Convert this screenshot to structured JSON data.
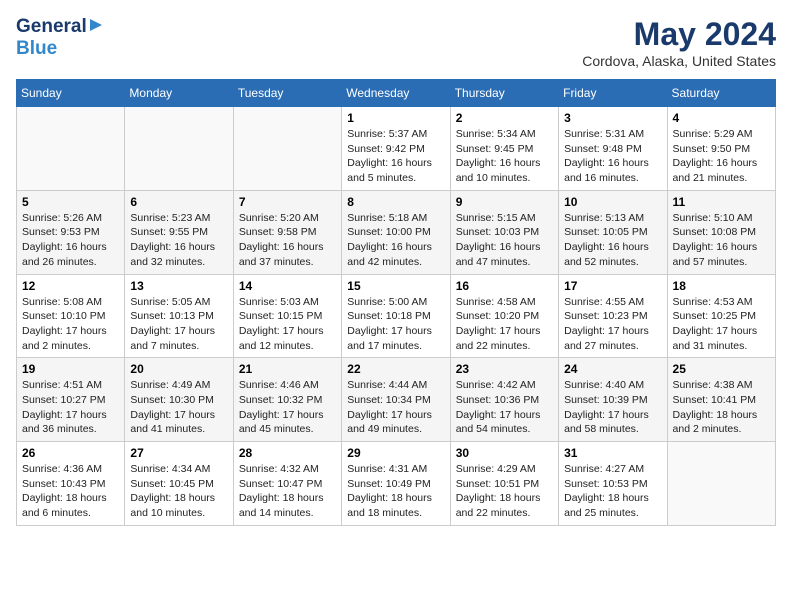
{
  "header": {
    "logo_general": "General",
    "logo_blue": "Blue",
    "month_year": "May 2024",
    "location": "Cordova, Alaska, United States"
  },
  "days_of_week": [
    "Sunday",
    "Monday",
    "Tuesday",
    "Wednesday",
    "Thursday",
    "Friday",
    "Saturday"
  ],
  "weeks": [
    [
      {
        "day": "",
        "content": ""
      },
      {
        "day": "",
        "content": ""
      },
      {
        "day": "",
        "content": ""
      },
      {
        "day": "1",
        "content": "Sunrise: 5:37 AM\nSunset: 9:42 PM\nDaylight: 16 hours\nand 5 minutes."
      },
      {
        "day": "2",
        "content": "Sunrise: 5:34 AM\nSunset: 9:45 PM\nDaylight: 16 hours\nand 10 minutes."
      },
      {
        "day": "3",
        "content": "Sunrise: 5:31 AM\nSunset: 9:48 PM\nDaylight: 16 hours\nand 16 minutes."
      },
      {
        "day": "4",
        "content": "Sunrise: 5:29 AM\nSunset: 9:50 PM\nDaylight: 16 hours\nand 21 minutes."
      }
    ],
    [
      {
        "day": "5",
        "content": "Sunrise: 5:26 AM\nSunset: 9:53 PM\nDaylight: 16 hours\nand 26 minutes."
      },
      {
        "day": "6",
        "content": "Sunrise: 5:23 AM\nSunset: 9:55 PM\nDaylight: 16 hours\nand 32 minutes."
      },
      {
        "day": "7",
        "content": "Sunrise: 5:20 AM\nSunset: 9:58 PM\nDaylight: 16 hours\nand 37 minutes."
      },
      {
        "day": "8",
        "content": "Sunrise: 5:18 AM\nSunset: 10:00 PM\nDaylight: 16 hours\nand 42 minutes."
      },
      {
        "day": "9",
        "content": "Sunrise: 5:15 AM\nSunset: 10:03 PM\nDaylight: 16 hours\nand 47 minutes."
      },
      {
        "day": "10",
        "content": "Sunrise: 5:13 AM\nSunset: 10:05 PM\nDaylight: 16 hours\nand 52 minutes."
      },
      {
        "day": "11",
        "content": "Sunrise: 5:10 AM\nSunset: 10:08 PM\nDaylight: 16 hours\nand 57 minutes."
      }
    ],
    [
      {
        "day": "12",
        "content": "Sunrise: 5:08 AM\nSunset: 10:10 PM\nDaylight: 17 hours\nand 2 minutes."
      },
      {
        "day": "13",
        "content": "Sunrise: 5:05 AM\nSunset: 10:13 PM\nDaylight: 17 hours\nand 7 minutes."
      },
      {
        "day": "14",
        "content": "Sunrise: 5:03 AM\nSunset: 10:15 PM\nDaylight: 17 hours\nand 12 minutes."
      },
      {
        "day": "15",
        "content": "Sunrise: 5:00 AM\nSunset: 10:18 PM\nDaylight: 17 hours\nand 17 minutes."
      },
      {
        "day": "16",
        "content": "Sunrise: 4:58 AM\nSunset: 10:20 PM\nDaylight: 17 hours\nand 22 minutes."
      },
      {
        "day": "17",
        "content": "Sunrise: 4:55 AM\nSunset: 10:23 PM\nDaylight: 17 hours\nand 27 minutes."
      },
      {
        "day": "18",
        "content": "Sunrise: 4:53 AM\nSunset: 10:25 PM\nDaylight: 17 hours\nand 31 minutes."
      }
    ],
    [
      {
        "day": "19",
        "content": "Sunrise: 4:51 AM\nSunset: 10:27 PM\nDaylight: 17 hours\nand 36 minutes."
      },
      {
        "day": "20",
        "content": "Sunrise: 4:49 AM\nSunset: 10:30 PM\nDaylight: 17 hours\nand 41 minutes."
      },
      {
        "day": "21",
        "content": "Sunrise: 4:46 AM\nSunset: 10:32 PM\nDaylight: 17 hours\nand 45 minutes."
      },
      {
        "day": "22",
        "content": "Sunrise: 4:44 AM\nSunset: 10:34 PM\nDaylight: 17 hours\nand 49 minutes."
      },
      {
        "day": "23",
        "content": "Sunrise: 4:42 AM\nSunset: 10:36 PM\nDaylight: 17 hours\nand 54 minutes."
      },
      {
        "day": "24",
        "content": "Sunrise: 4:40 AM\nSunset: 10:39 PM\nDaylight: 17 hours\nand 58 minutes."
      },
      {
        "day": "25",
        "content": "Sunrise: 4:38 AM\nSunset: 10:41 PM\nDaylight: 18 hours\nand 2 minutes."
      }
    ],
    [
      {
        "day": "26",
        "content": "Sunrise: 4:36 AM\nSunset: 10:43 PM\nDaylight: 18 hours\nand 6 minutes."
      },
      {
        "day": "27",
        "content": "Sunrise: 4:34 AM\nSunset: 10:45 PM\nDaylight: 18 hours\nand 10 minutes."
      },
      {
        "day": "28",
        "content": "Sunrise: 4:32 AM\nSunset: 10:47 PM\nDaylight: 18 hours\nand 14 minutes."
      },
      {
        "day": "29",
        "content": "Sunrise: 4:31 AM\nSunset: 10:49 PM\nDaylight: 18 hours\nand 18 minutes."
      },
      {
        "day": "30",
        "content": "Sunrise: 4:29 AM\nSunset: 10:51 PM\nDaylight: 18 hours\nand 22 minutes."
      },
      {
        "day": "31",
        "content": "Sunrise: 4:27 AM\nSunset: 10:53 PM\nDaylight: 18 hours\nand 25 minutes."
      },
      {
        "day": "",
        "content": ""
      }
    ]
  ]
}
